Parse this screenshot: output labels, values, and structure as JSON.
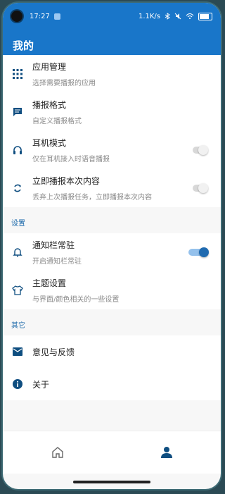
{
  "status_bar": {
    "time": "17:27",
    "network_speed": "1.1K/s"
  },
  "header": {
    "title": "我的"
  },
  "main_items": [
    {
      "label": "应用管理",
      "sub": "选择需要播报的应用"
    },
    {
      "label": "播报格式",
      "sub": "自定义播报格式"
    },
    {
      "label": "耳机模式",
      "sub": "仅在耳机接入时语音播报"
    },
    {
      "label": "立即播报本次内容",
      "sub": "丢弃上次播报任务，立即播报本次内容"
    }
  ],
  "settings": {
    "title": "设置",
    "items": [
      {
        "label": "通知栏常驻",
        "sub": "开启通知栏常驻"
      },
      {
        "label": "主题设置",
        "sub": "与界面/颜色相关的一些设置"
      }
    ]
  },
  "other": {
    "title": "其它",
    "items": [
      {
        "label": "意见与反馈"
      },
      {
        "label": "关于"
      }
    ]
  },
  "toggles": {
    "headphone_mode": false,
    "immediate_broadcast": false,
    "notification_resident": true
  },
  "colors": {
    "primary": "#1976c9",
    "icon": "#0f4e80",
    "section_title": "#1565a8"
  },
  "icons": {
    "app_manage": "grid-icon",
    "broadcast_format": "message-icon",
    "headphone": "headphones-icon",
    "immediate": "refresh-icon",
    "notification": "bell-icon",
    "theme": "shirt-icon",
    "feedback": "mail-icon",
    "about": "info-icon",
    "nav_home": "home-icon",
    "nav_profile": "person-icon"
  }
}
